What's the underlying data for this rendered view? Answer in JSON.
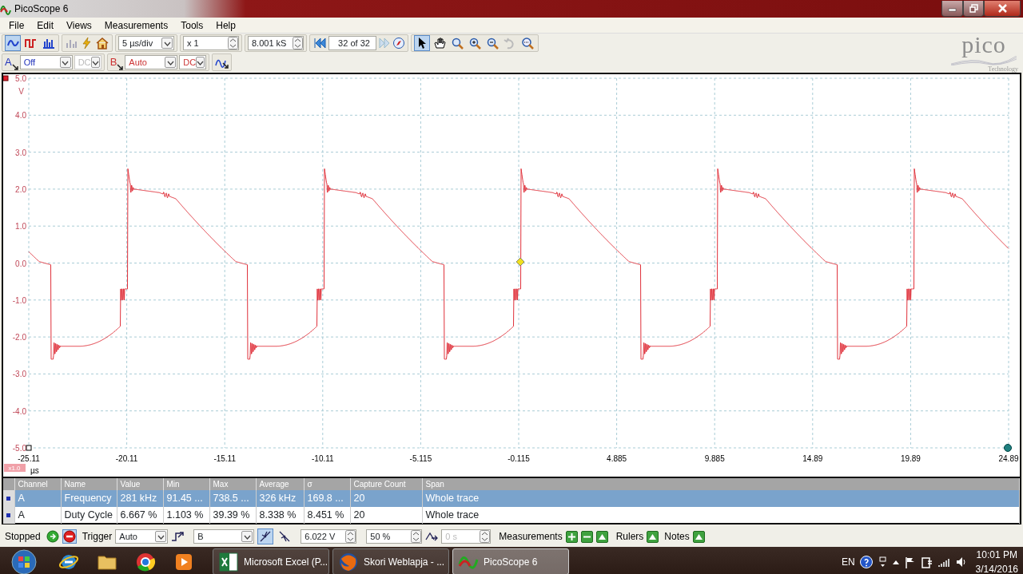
{
  "window": {
    "title": "PicoScope 6"
  },
  "menu": [
    {
      "label": "File"
    },
    {
      "label": "Edit"
    },
    {
      "label": "Views"
    },
    {
      "label": "Measurements"
    },
    {
      "label": "Tools"
    },
    {
      "label": "Help"
    }
  ],
  "view_modes": [
    {
      "kind": "scope",
      "selected": true
    },
    {
      "kind": "persistence",
      "selected": false
    },
    {
      "kind": "spectrum",
      "selected": false
    }
  ],
  "toolbar": {
    "timebase": "5 µs/div",
    "zoom": "x 1",
    "samples": "8.001 kS",
    "capture": "32 of 32"
  },
  "tools": [
    {
      "kind": "pointer",
      "selected": true
    },
    {
      "kind": "hand",
      "selected": false
    },
    {
      "kind": "zoom-area",
      "selected": false
    },
    {
      "kind": "zoom-in",
      "selected": false
    },
    {
      "kind": "zoom-out",
      "selected": false
    },
    {
      "kind": "undo",
      "selected": false
    },
    {
      "kind": "zoom-fit",
      "selected": false
    }
  ],
  "channels": [
    {
      "label": "A",
      "color": "#2233bb",
      "range": "Off",
      "coupling": "DC",
      "coupling_disabled": true
    },
    {
      "label": "B",
      "color": "#cc3333",
      "range": "Auto",
      "coupling": "DC",
      "coupling_disabled": false
    }
  ],
  "logo": {
    "name": "pico",
    "tagline": "Technology"
  },
  "plot": {
    "y_labels": [
      "5.0",
      "4.0",
      "3.0",
      "2.0",
      "1.0",
      "0.0",
      "-1.0",
      "-2.0",
      "-3.0",
      "-4.0",
      "-5.0"
    ],
    "y_unit": "V",
    "x_labels": [
      "-25.11",
      "-20.11",
      "-15.11",
      "-10.11",
      "-5.115",
      "-0.115",
      "4.885",
      "9.885",
      "14.89",
      "19.89",
      "24.89"
    ],
    "x_unit": "µs",
    "zoom_badge": "x1.0"
  },
  "measurements": {
    "columns": [
      "Channel",
      "Name",
      "Value",
      "Min",
      "Max",
      "Average",
      "σ",
      "Capture Count",
      "Span"
    ],
    "rows": [
      {
        "selected": true,
        "cells": [
          "A",
          "Frequency",
          "281 kHz",
          "91.45 ...",
          "738.5 ...",
          "326 kHz",
          "169.8 ...",
          "20",
          "Whole trace"
        ]
      },
      {
        "selected": false,
        "cells": [
          "A",
          "Duty Cycle",
          "6.667 %",
          "1.103 %",
          "39.39 %",
          "8.338 %",
          "8.451 %",
          "20",
          "Whole trace"
        ]
      }
    ]
  },
  "status": {
    "state": "Stopped",
    "trigger_label": "Trigger",
    "trigger_mode": "Auto",
    "trigger_source": "B",
    "edges": [
      {
        "kind": "rising",
        "selected": true
      },
      {
        "kind": "falling",
        "selected": false
      }
    ],
    "threshold": "6.022 V",
    "pretrigger": "50 %",
    "delay": "0 s",
    "measurements_label": "Measurements",
    "rulers_label": "Rulers",
    "notes_label": "Notes"
  },
  "taskbar": {
    "pinned": [
      {
        "kind": "ie"
      },
      {
        "kind": "folder"
      },
      {
        "kind": "chrome"
      },
      {
        "kind": "media"
      }
    ],
    "tasks": [
      {
        "kind": "excel",
        "label": "Microsoft Excel (P...",
        "selected": false
      },
      {
        "kind": "firefox",
        "label": "Skori Weblapja - ...",
        "selected": false
      },
      {
        "kind": "scope",
        "label": "PicoScope 6",
        "selected": true
      }
    ],
    "language": "EN",
    "time": "10:01 PM",
    "date": "3/14/2016"
  }
}
